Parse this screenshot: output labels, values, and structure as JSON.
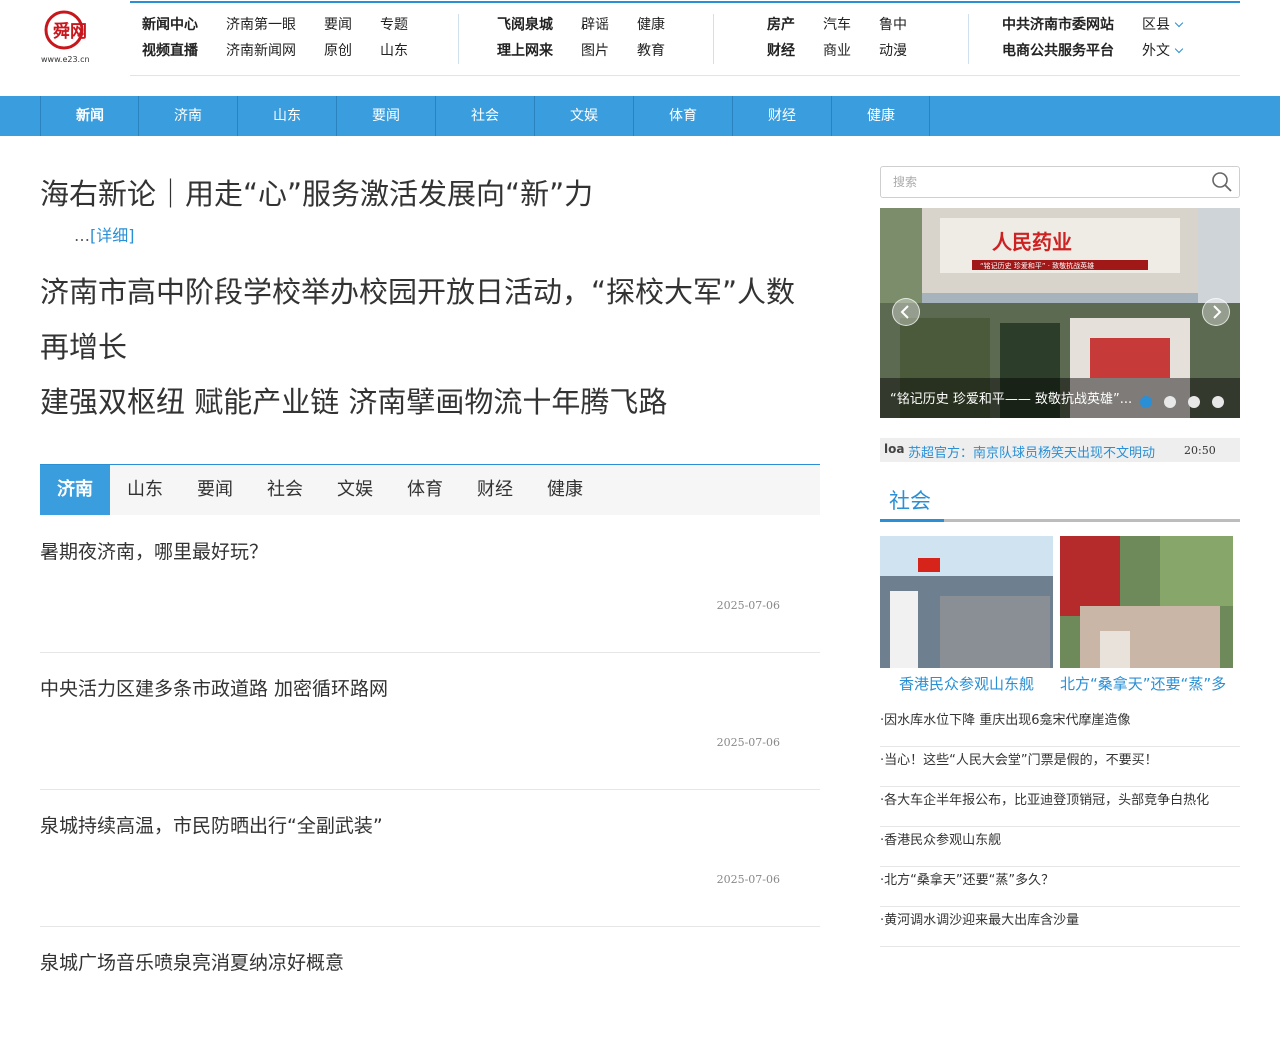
{
  "header": {
    "logo_text": "舜网",
    "logo_url_text": "www.e23.cn",
    "group1": {
      "row1": [
        "新闻中心",
        "济南第一眼",
        "要闻",
        "专题"
      ],
      "row2": [
        "视频直播",
        "济南新闻网",
        "原创",
        "山东"
      ]
    },
    "group2": {
      "row1": [
        "飞阅泉城",
        "辟谣",
        "健康"
      ],
      "row2": [
        "理上网来",
        "图片",
        "教育"
      ]
    },
    "group3": {
      "row1": [
        "房产",
        "汽车",
        "鲁中"
      ],
      "row2": [
        "财经",
        "商业",
        "动漫"
      ]
    },
    "group4": {
      "row1": [
        "中共济南市委网站",
        "区县"
      ],
      "row2": [
        "电商公共服务平台",
        "外文"
      ]
    }
  },
  "channels": [
    "新闻",
    "济南",
    "山东",
    "要闻",
    "社会",
    "文娱",
    "体育",
    "财经",
    "健康"
  ],
  "headlines": {
    "h1": "海右新论｜用走“心”服务激活发展向“新”力",
    "detail_prefix": "…",
    "detail_link": "[详细]",
    "h2_line1": "济南市高中阶段学校举办校园开放日活动，“探校大军”人数",
    "h2_line2": "再增长",
    "h3": "建强双枢纽 赋能产业链 济南擘画物流十年腾飞路"
  },
  "tabs": [
    "济南",
    "山东",
    "要闻",
    "社会",
    "文娱",
    "体育",
    "财经",
    "健康"
  ],
  "news": [
    {
      "title": "暑期夜济南，哪里最好玩？",
      "date": "2025-07-06"
    },
    {
      "title": "中央活力区建多条市政道路 加密循环路网",
      "date": "2025-07-06"
    },
    {
      "title": "泉城持续高温，市民防晒出行“全副武装”",
      "date": "2025-07-06"
    },
    {
      "title": "泉城广场音乐喷泉亮消夏纳凉好概意",
      "date": ""
    }
  ],
  "search": {
    "placeholder": "搜索"
  },
  "slider": {
    "sign_text": "人民药业",
    "banner_text": "“铭记历史 珍爱和平” · 致敬抗战英雄",
    "caption": "“铭记历史 珍爱和平—— 致敬抗战英雄”..."
  },
  "ticker": {
    "label": "loa",
    "text": "苏超官方：南京队球员杨笑天出现不文明动",
    "time": "20:50"
  },
  "social": {
    "title": "社会",
    "photos": [
      {
        "caption": "香港民众参观山东舰"
      },
      {
        "caption": "北方“桑拿天”还要“蒸”多"
      }
    ],
    "list": [
      "·因水库水位下降 重庆出现6龛宋代摩崖造像",
      "·当心！这些“人民大会堂”门票是假的，不要买！",
      "·各大车企半年报公布，比亚迪登顶销冠，头部竞争白热化",
      "·香港民众参观山东舰",
      "·北方“桑拿天”还要“蒸”多久？",
      "·黄河调水调沙迎来最大出库含沙量"
    ]
  },
  "colors": {
    "accent": "#2a8fd4",
    "channel_bar": "#3a9ddd",
    "logo_red": "#c8161d"
  }
}
